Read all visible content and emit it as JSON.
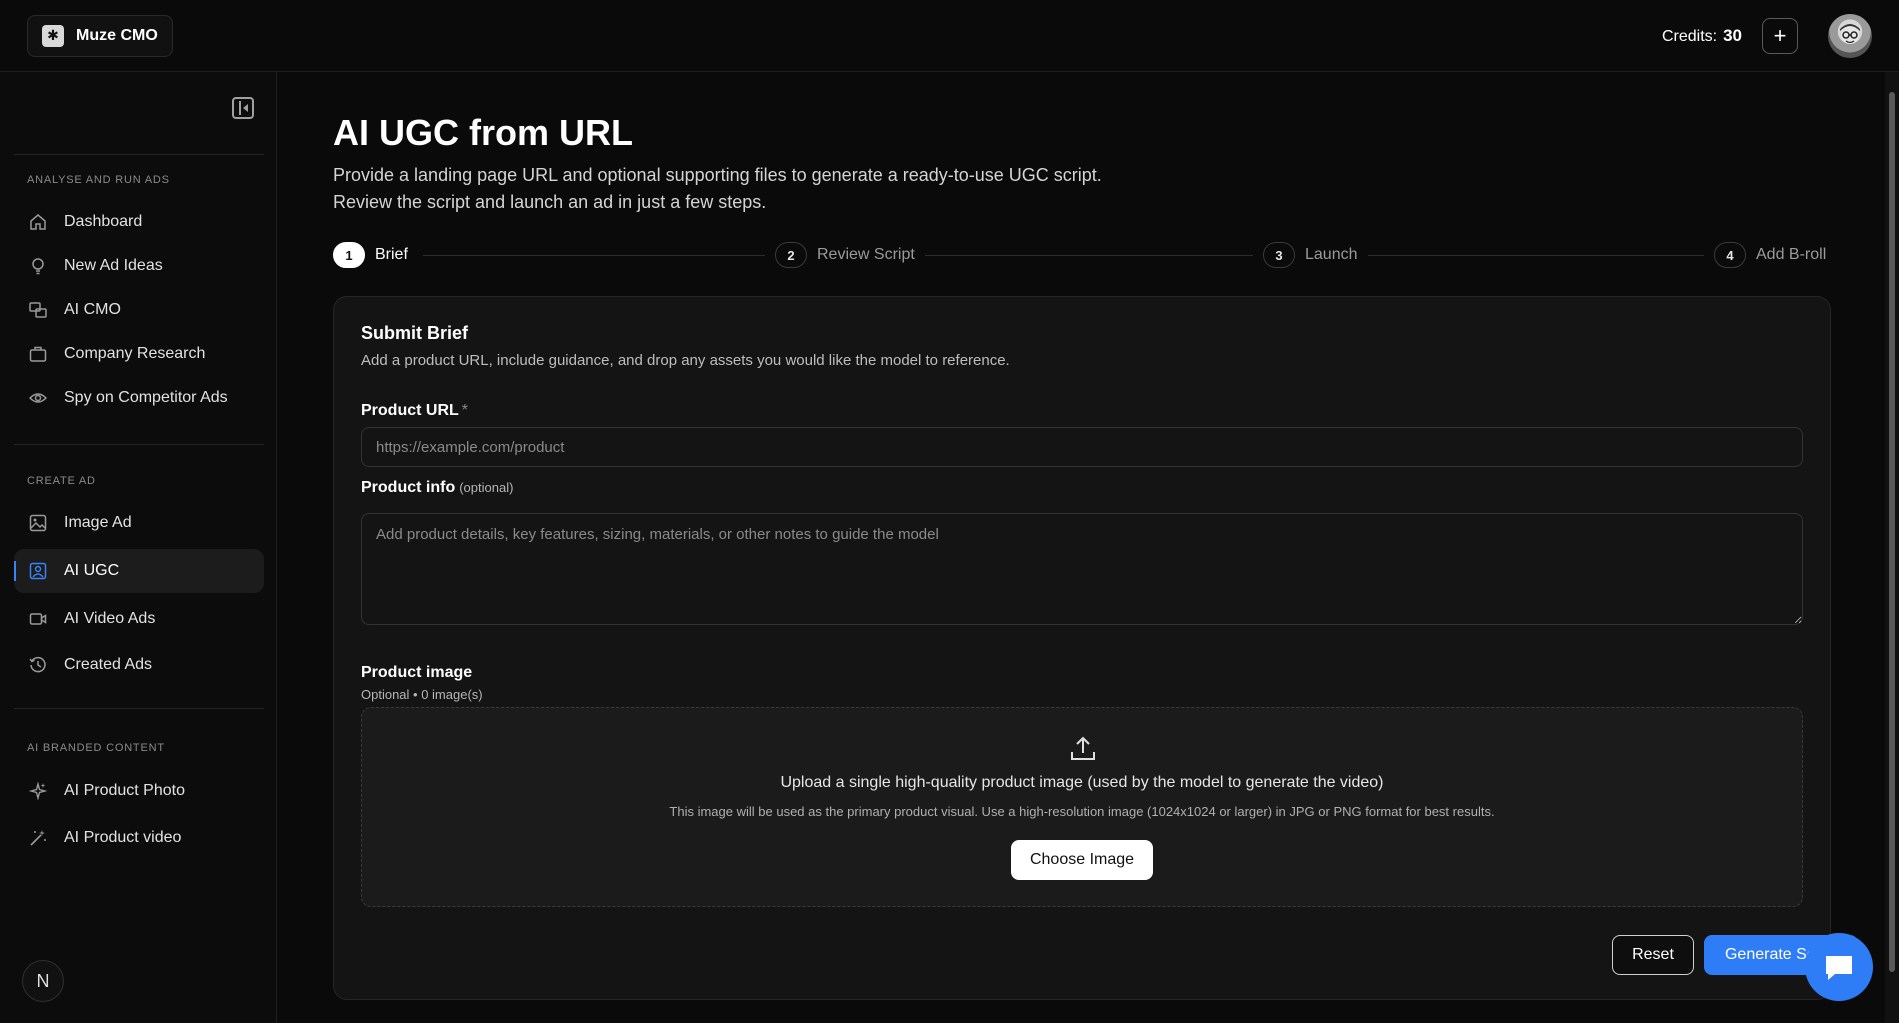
{
  "header": {
    "brand_name": "Muze CMO",
    "credits_label": "Credits:",
    "credits_value": "30",
    "add_credits_symbol": "+"
  },
  "sidebar": {
    "sections": [
      {
        "label": "ANALYSE AND RUN ADS",
        "items": [
          {
            "label": "Dashboard",
            "icon": "home-icon"
          },
          {
            "label": "New Ad Ideas",
            "icon": "lightbulb-icon"
          },
          {
            "label": "AI CMO",
            "icon": "chat-bubbles-icon"
          },
          {
            "label": "Company Research",
            "icon": "briefcase-icon"
          },
          {
            "label": "Spy on Competitor Ads",
            "icon": "eye-icon"
          }
        ]
      },
      {
        "label": "CREATE AD",
        "items": [
          {
            "label": "Image Ad",
            "icon": "image-icon"
          },
          {
            "label": "AI UGC",
            "icon": "user-square-icon",
            "active": true
          },
          {
            "label": "AI Video Ads",
            "icon": "video-camera-icon"
          },
          {
            "label": "Created Ads",
            "icon": "history-icon"
          }
        ]
      },
      {
        "label": "AI BRANDED CONTENT",
        "items": [
          {
            "label": "AI Product Photo",
            "icon": "sparkles-icon"
          },
          {
            "label": "AI Product video",
            "icon": "magic-wand-icon"
          }
        ]
      }
    ],
    "footer_badge": "N"
  },
  "main": {
    "title": "AI UGC from URL",
    "description": "Provide a landing page URL and optional supporting files to generate a ready-to-use UGC script. Review the script and launch an ad in just a few steps.",
    "steps": [
      {
        "num": "1",
        "label": "Brief",
        "active": true
      },
      {
        "num": "2",
        "label": "Review Script"
      },
      {
        "num": "3",
        "label": "Launch"
      },
      {
        "num": "4",
        "label": "Add B-roll"
      }
    ],
    "card": {
      "title": "Submit Brief",
      "subtitle": "Add a product URL, include guidance, and drop any assets you would like the model to reference.",
      "product_url_label": "Product URL",
      "required_mark": "*",
      "product_url_placeholder": "https://example.com/product",
      "product_url_value": "",
      "product_info_label": "Product info",
      "optional_tag": "(optional)",
      "product_info_placeholder": "Add product details, key features, sizing, materials, or other notes to guide the model",
      "product_image_label": "Product image",
      "product_image_sub": "Optional • 0 image(s)",
      "dropzone_title": "Upload a single high-quality product image (used by the model to generate the video)",
      "dropzone_sub": "This image will be used as the primary product visual. Use a high-resolution image (1024x1024 or larger) in JPG or PNG format for best results.",
      "choose_image_label": "Choose Image",
      "reset_label": "Reset",
      "generate_label": "Generate Script"
    }
  },
  "colors": {
    "accent": "#2f7df6",
    "background": "#0a0a0a",
    "card": "#141414"
  }
}
